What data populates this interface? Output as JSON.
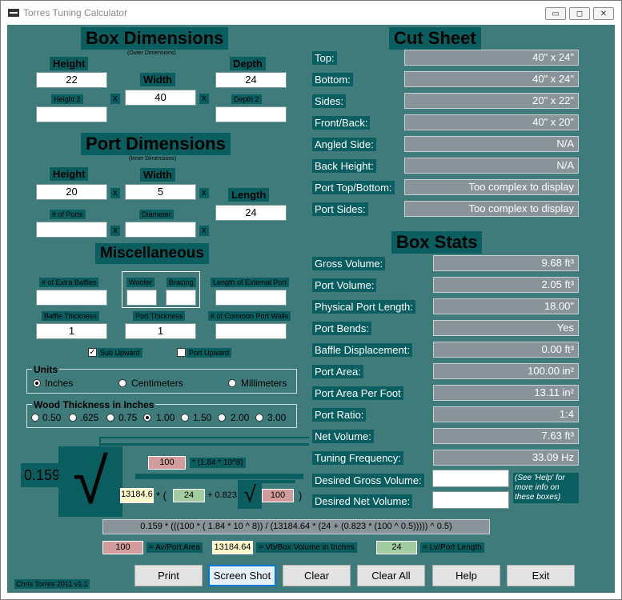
{
  "window": {
    "title": "Torres Tuning Calculator"
  },
  "box": {
    "title": "Box Dimensions",
    "subtitle": "(Outer Dimensions)",
    "height_label": "Height",
    "height": "22",
    "width_label": "Width",
    "width": "40",
    "depth_label": "Depth",
    "depth": "24",
    "height2_label": "Height 2",
    "height2": "",
    "depth2_label": "Depth 2",
    "depth2": "",
    "x": "x"
  },
  "port": {
    "title": "Port Dimensions",
    "subtitle": "(Inner Dimensions)",
    "height_label": "Height",
    "height": "20",
    "width_label": "Width",
    "width": "5",
    "length_label": "Length",
    "length": "24",
    "ports_label": "# of Ports",
    "ports": "",
    "diameter_label": "Diameter",
    "diameter": ""
  },
  "misc": {
    "title": "Miscellaneous",
    "extra_baffles_label": "# of Extra Baffles",
    "extra_baffles": "",
    "woofer_label": "Woofer",
    "woofer": "",
    "bracing_label": "Bracing",
    "bracing": "",
    "ext_port_label": "Length of External Port",
    "ext_port": "",
    "baffle_thickness_label": "Baffle Thickness",
    "baffle_thickness": "1",
    "port_thickness_label": "Port Thickness",
    "port_thickness": "1",
    "common_walls_label": "# of Common Port Walls",
    "common_walls": "",
    "sub_upward_label": "Sub Upward",
    "sub_upward_check": "✓",
    "port_upward_label": "Port Upward"
  },
  "units": {
    "title": "Units",
    "options": [
      "Inches",
      "Centimeters",
      "Millimeters"
    ],
    "selected": "Inches"
  },
  "wood": {
    "title": "Wood Thickness in Inches",
    "options": [
      "0.50",
      ".625",
      "0.75",
      "1.00",
      "1.50",
      "2.00",
      "3.00"
    ],
    "selected": "1.00"
  },
  "cut_sheet": {
    "title": "Cut Sheet",
    "rows": [
      {
        "label": "Top:",
        "value": "40\" x 24\""
      },
      {
        "label": "Bottom:",
        "value": "40\" x 24\""
      },
      {
        "label": "Sides:",
        "value": "20\" x 22\""
      },
      {
        "label": "Front/Back:",
        "value": "40\" x 20\""
      },
      {
        "label": "Angled Side:",
        "value": "N/A"
      },
      {
        "label": "Back Height:",
        "value": "N/A"
      },
      {
        "label": "Port Top/Bottom:",
        "value": "Too complex to display"
      },
      {
        "label": "Port Sides:",
        "value": "Too complex to display"
      }
    ]
  },
  "box_stats": {
    "title": "Box Stats",
    "rows": [
      {
        "label": "Gross Volume:",
        "value": "9.68 ft³"
      },
      {
        "label": "Port Volume:",
        "value": "2.05 ft³"
      },
      {
        "label": "Physical Port Length:",
        "value": "18.00\""
      },
      {
        "label": "Port Bends:",
        "value": "Yes"
      },
      {
        "label": "Baffle Displacement:",
        "value": "0.00 ft³"
      },
      {
        "label": "Port Area:",
        "value": "100.00 in²"
      },
      {
        "label": "Port Area Per Foot",
        "value": "13.11 in²"
      },
      {
        "label": "Port Ratio:",
        "value": "1:4"
      },
      {
        "label": "Net Volume:",
        "value": "7.63 ft³"
      },
      {
        "label": "Tuning Frequency:",
        "value": "33.09 Hz"
      }
    ],
    "desired_gross_label": "Desired Gross Volume:",
    "desired_gross": "",
    "desired_net_label": "Desired Net Volume:",
    "desired_net": "",
    "help_note": "(See 'Help' for more info on these boxes)"
  },
  "formula": {
    "constant": "0.159",
    "root": "√",
    "av": "100",
    "exp_text": "* (1.84 * 10^8)",
    "vb": "13184.64",
    "times_paren": "* (",
    "lv": "24",
    "plus": "+ 0.823 *",
    "av2": "100",
    "close": ")",
    "full_expression": "0.159 * (((100 * ( 1.84 * 10 ^ 8)) / (13184.64 * (24 + (0.823 * (100 ^ 0.5))))) ^ 0.5)",
    "legend": [
      {
        "value": "100",
        "label": "= Av/Port Area"
      },
      {
        "value": "13184.64",
        "label": "= Vb/Box Volume in Inches"
      },
      {
        "value": "24",
        "label": "= Lv/Port Length"
      }
    ]
  },
  "buttons": {
    "print": "Print",
    "screenshot": "Screen Shot",
    "clear": "Clear",
    "clear_all": "Clear All",
    "help": "Help",
    "exit": "Exit"
  },
  "credit": "Chris Torres 2011 v1.1"
}
